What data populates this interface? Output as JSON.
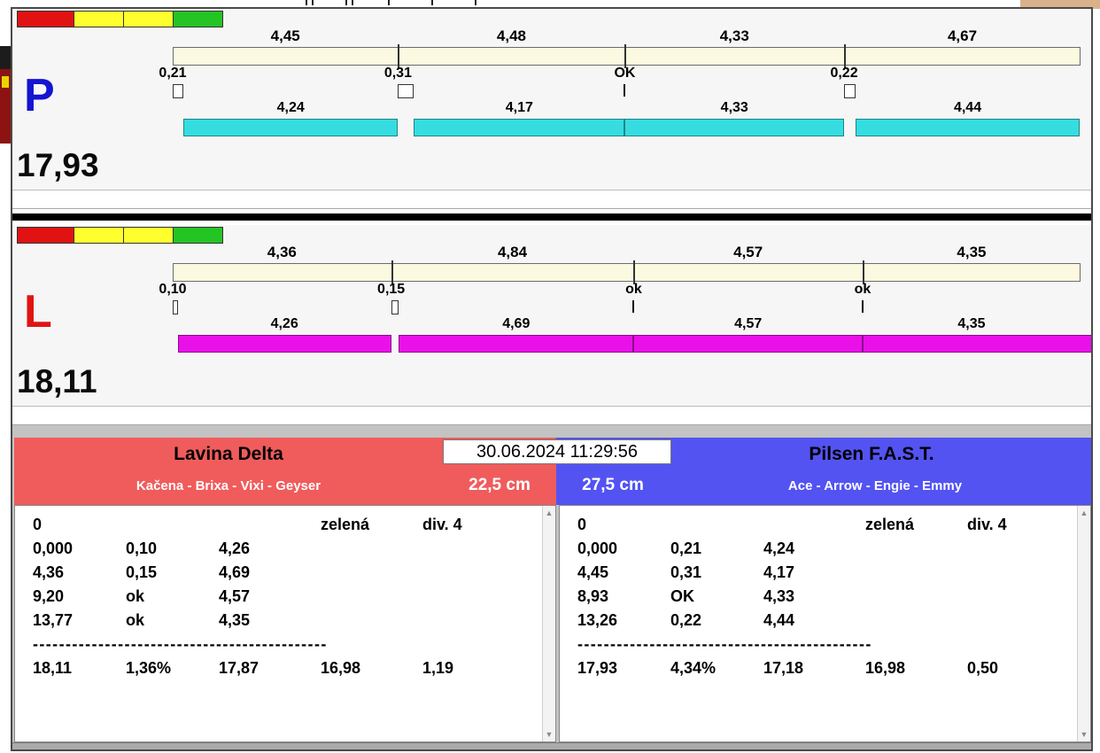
{
  "meta": {
    "timestamp": "30.06.2024 11:29:56"
  },
  "icons": {
    "scroll_up": "▲",
    "scroll_down": "▼"
  },
  "lanes": [
    {
      "id": "P",
      "letter": "P",
      "letter_color": "#1414d2",
      "dog_bar_color": "#35dde0",
      "total_display": "17,93",
      "lights": [
        "#e11212",
        "#ffff2e",
        "#ffff2e",
        "#24c424"
      ],
      "splits": [
        {
          "label": "4,45",
          "t": 4.45
        },
        {
          "label": "4,48",
          "t": 4.48
        },
        {
          "label": "4,33",
          "t": 4.33
        },
        {
          "label": "4,67",
          "t": 4.67
        }
      ],
      "passes": [
        {
          "label": "0,21",
          "t": 0.21,
          "mark": "box"
        },
        {
          "label": "0,31",
          "t": 0.31,
          "mark": "box"
        },
        {
          "label": "OK",
          "t": 0,
          "mark": "tick"
        },
        {
          "label": "0,22",
          "t": 0.22,
          "mark": "box"
        }
      ],
      "dogs": [
        {
          "label": "4,24",
          "t": 4.24
        },
        {
          "label": "4,17",
          "t": 4.17
        },
        {
          "label": "4,33",
          "t": 4.33
        },
        {
          "label": "4,44",
          "t": 4.44
        }
      ]
    },
    {
      "id": "L",
      "letter": "L",
      "letter_color": "#e01414",
      "dog_bar_color": "#ea10ea",
      "total_display": "18,11",
      "lights": [
        "#e11212",
        "#ffff2e",
        "#ffff2e",
        "#24c424"
      ],
      "splits": [
        {
          "label": "4,36",
          "t": 4.36
        },
        {
          "label": "4,84",
          "t": 4.84
        },
        {
          "label": "4,57",
          "t": 4.57
        },
        {
          "label": "4,35",
          "t": 4.35
        }
      ],
      "passes": [
        {
          "label": "0,10",
          "t": 0.1,
          "mark": "box"
        },
        {
          "label": "0,15",
          "t": 0.15,
          "mark": "box"
        },
        {
          "label": "ok",
          "t": 0,
          "mark": "tick"
        },
        {
          "label": "ok",
          "t": 0,
          "mark": "tick"
        }
      ],
      "dogs": [
        {
          "label": "4,26",
          "t": 4.26
        },
        {
          "label": "4,69",
          "t": 4.69
        },
        {
          "label": "4,57",
          "t": 4.57
        },
        {
          "label": "4,35",
          "t": 4.35
        }
      ]
    }
  ],
  "teams": [
    {
      "name": "Lavina Delta",
      "dogs_line": "Kačena - Brixa - Vixi - Geyser",
      "height": "22,5 cm",
      "header_color": "#f05c5c",
      "info_row": [
        "0",
        "",
        "",
        "zelená",
        "div. 4"
      ],
      "rows": [
        [
          "0,000",
          "0,10",
          "4,26",
          "",
          ""
        ],
        [
          "4,36",
          "0,15",
          "4,69",
          "",
          ""
        ],
        [
          "9,20",
          "ok",
          "4,57",
          "",
          ""
        ],
        [
          "13,77",
          "ok",
          "4,35",
          "",
          ""
        ]
      ],
      "separator": "---------------------------------------------",
      "summary": [
        "18,11",
        "1,36%",
        "17,87",
        "16,98",
        "1,19"
      ]
    },
    {
      "name": "Pilsen F.A.S.T.",
      "dogs_line": "Ace - Arrow - Engie - Emmy",
      "height": "27,5 cm",
      "header_color": "#5353f2",
      "info_row": [
        "0",
        "",
        "",
        "zelená",
        "div. 4"
      ],
      "rows": [
        [
          "0,000",
          "0,21",
          "4,24",
          "",
          ""
        ],
        [
          "4,45",
          "0,31",
          "4,17",
          "",
          ""
        ],
        [
          "8,93",
          "OK",
          "4,33",
          "",
          ""
        ],
        [
          "13,26",
          "0,22",
          "4,44",
          "",
          ""
        ]
      ],
      "separator": "---------------------------------------------",
      "summary": [
        "17,93",
        "4,34%",
        "17,18",
        "16,98",
        "0,50"
      ]
    }
  ]
}
